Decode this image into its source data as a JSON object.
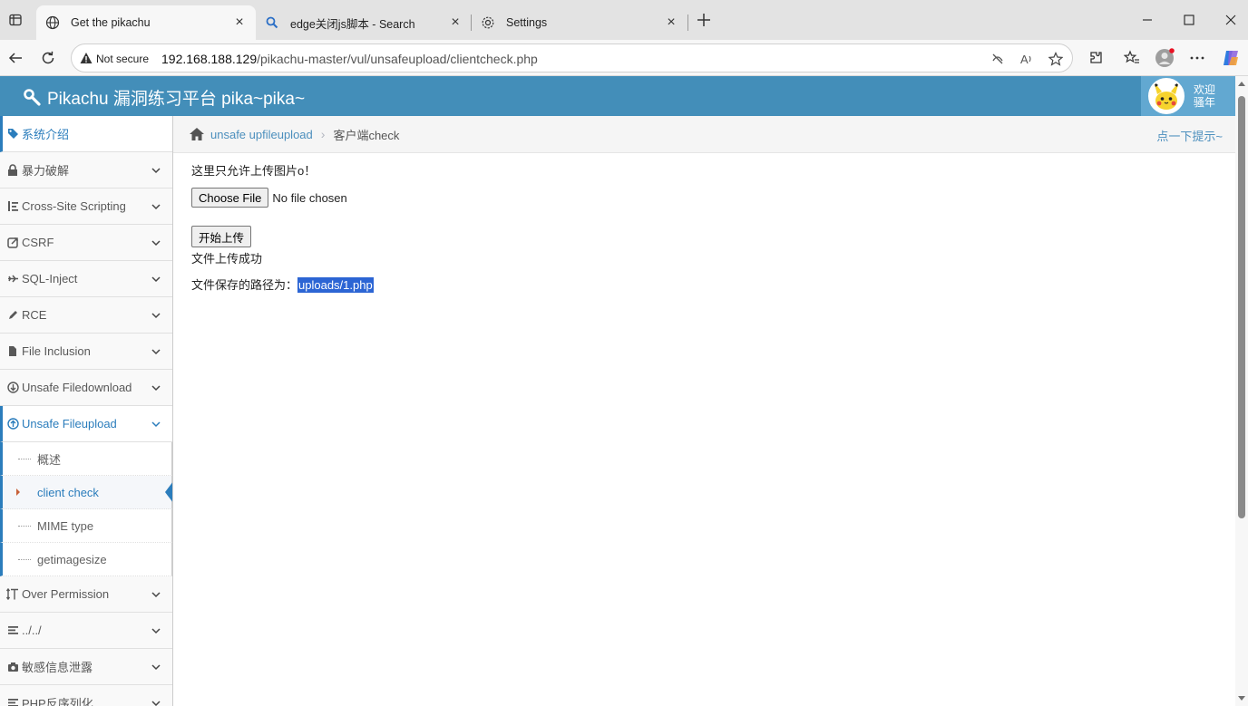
{
  "browser": {
    "tabs": [
      {
        "title": "Get the pikachu",
        "icon": "globe-icon",
        "active": true
      },
      {
        "title": "edge关闭js脚本 - Search",
        "icon": "search-icon",
        "active": false
      },
      {
        "title": "Settings",
        "icon": "gear-icon",
        "active": false
      }
    ],
    "address": {
      "security_label": "Not secure",
      "host": "192.168.188.129",
      "path": "/pikachu-master/vul/unsafeupload/clientcheck.php"
    }
  },
  "header": {
    "brand": "Pikachu 漏洞练习平台 pika~pika~",
    "welcome_line1": "欢迎",
    "welcome_line2": "骚年"
  },
  "sidebar": {
    "items": [
      {
        "label": "系统介绍",
        "icon": "tag-icon"
      },
      {
        "label": "暴力破解",
        "icon": "lock-icon"
      },
      {
        "label": "Cross-Site Scripting",
        "icon": "list-icon"
      },
      {
        "label": "CSRF",
        "icon": "share-icon"
      },
      {
        "label": "SQL-Inject",
        "icon": "plane-icon"
      },
      {
        "label": "RCE",
        "icon": "pencil-icon"
      },
      {
        "label": "File Inclusion",
        "icon": "file-icon"
      },
      {
        "label": "Unsafe Filedownload",
        "icon": "download-icon"
      },
      {
        "label": "Unsafe Fileupload",
        "icon": "upload-icon"
      },
      {
        "label": "Over Permission",
        "icon": "text-height-icon"
      },
      {
        "label": "../../",
        "icon": "align-icon"
      },
      {
        "label": "敏感信息泄露",
        "icon": "camera-icon"
      },
      {
        "label": "PHP反序列化",
        "icon": "align-icon"
      }
    ],
    "subitems": [
      {
        "label": "概述"
      },
      {
        "label": "client check"
      },
      {
        "label": "MIME type"
      },
      {
        "label": "getimagesize"
      }
    ]
  },
  "breadcrumb": {
    "parent": "unsafe upfileupload",
    "current": "客户端check",
    "hint": "点一下提示~"
  },
  "main": {
    "intro": "这里只允许上传图片o！",
    "choose_file_label": "Choose File",
    "file_status": "No file chosen",
    "upload_button": "开始上传",
    "success_text": "文件上传成功",
    "path_label": "文件保存的路径为：",
    "path_value": "uploads/1.php"
  },
  "colors": {
    "header_bg": "#438eb9",
    "accent": "#2b7dbc",
    "selection": "#2c65d4"
  }
}
